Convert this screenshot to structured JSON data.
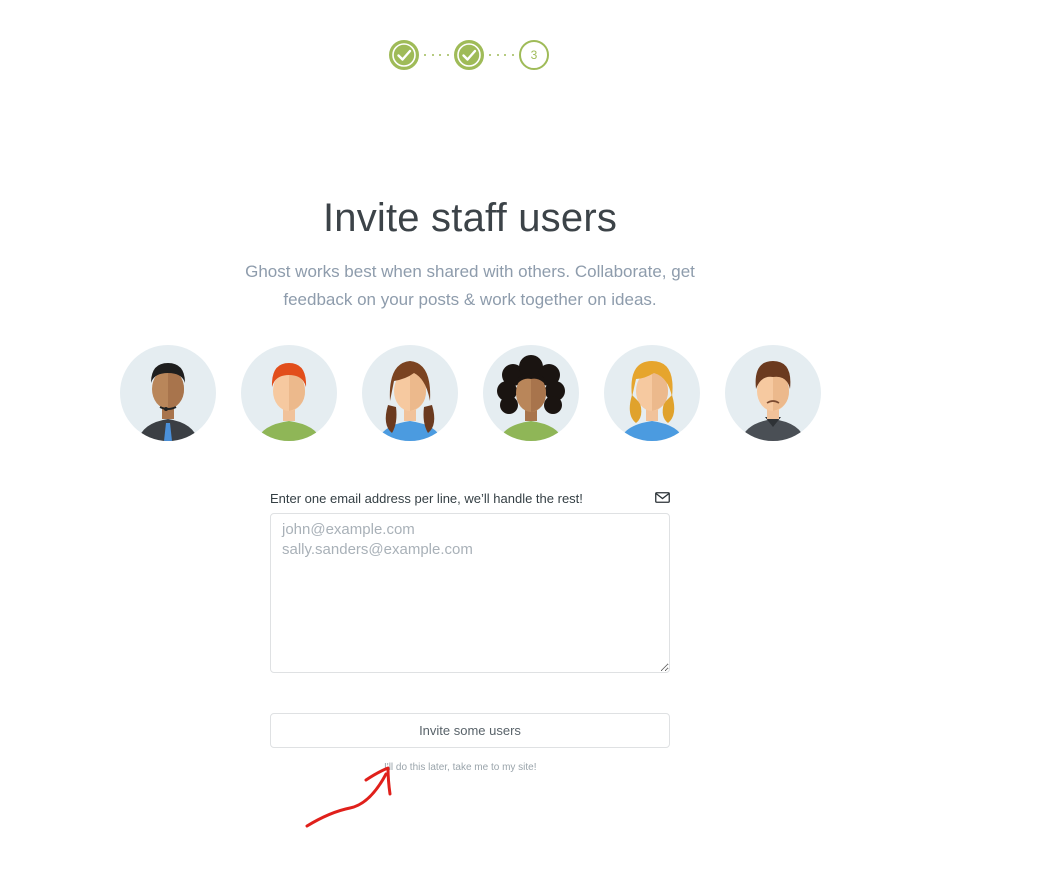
{
  "progress": {
    "steps": [
      {
        "state": "done",
        "icon": "check-icon"
      },
      {
        "state": "done",
        "icon": "check-icon"
      },
      {
        "state": "current",
        "number": "3"
      }
    ],
    "accent_color": "#9fbb58"
  },
  "page": {
    "title": "Invite staff users",
    "subtitle": "Ghost works best when shared with others. Collaborate, get feedback on your posts & work together on ideas."
  },
  "avatars": [
    {
      "icon": "man-dark-skin-headset-avatar-icon"
    },
    {
      "icon": "man-red-hair-avatar-icon"
    },
    {
      "icon": "girl-pigtails-avatar-icon"
    },
    {
      "icon": "woman-curly-hair-avatar-icon"
    },
    {
      "icon": "woman-blonde-hair-avatar-icon"
    },
    {
      "icon": "man-brown-hair-avatar-icon"
    }
  ],
  "invite_form": {
    "label": "Enter one email address per line, we’ll handle the rest!",
    "label_icon": "envelope-icon",
    "placeholder": "john@example.com\nsally.sanders@example.com",
    "value": "",
    "submit_label": "Invite some users",
    "skip_label": "I'll do this later, take me to my site!"
  },
  "annotation": {
    "icon": "red-arrow-annotation-icon",
    "color": "#e0201b"
  }
}
